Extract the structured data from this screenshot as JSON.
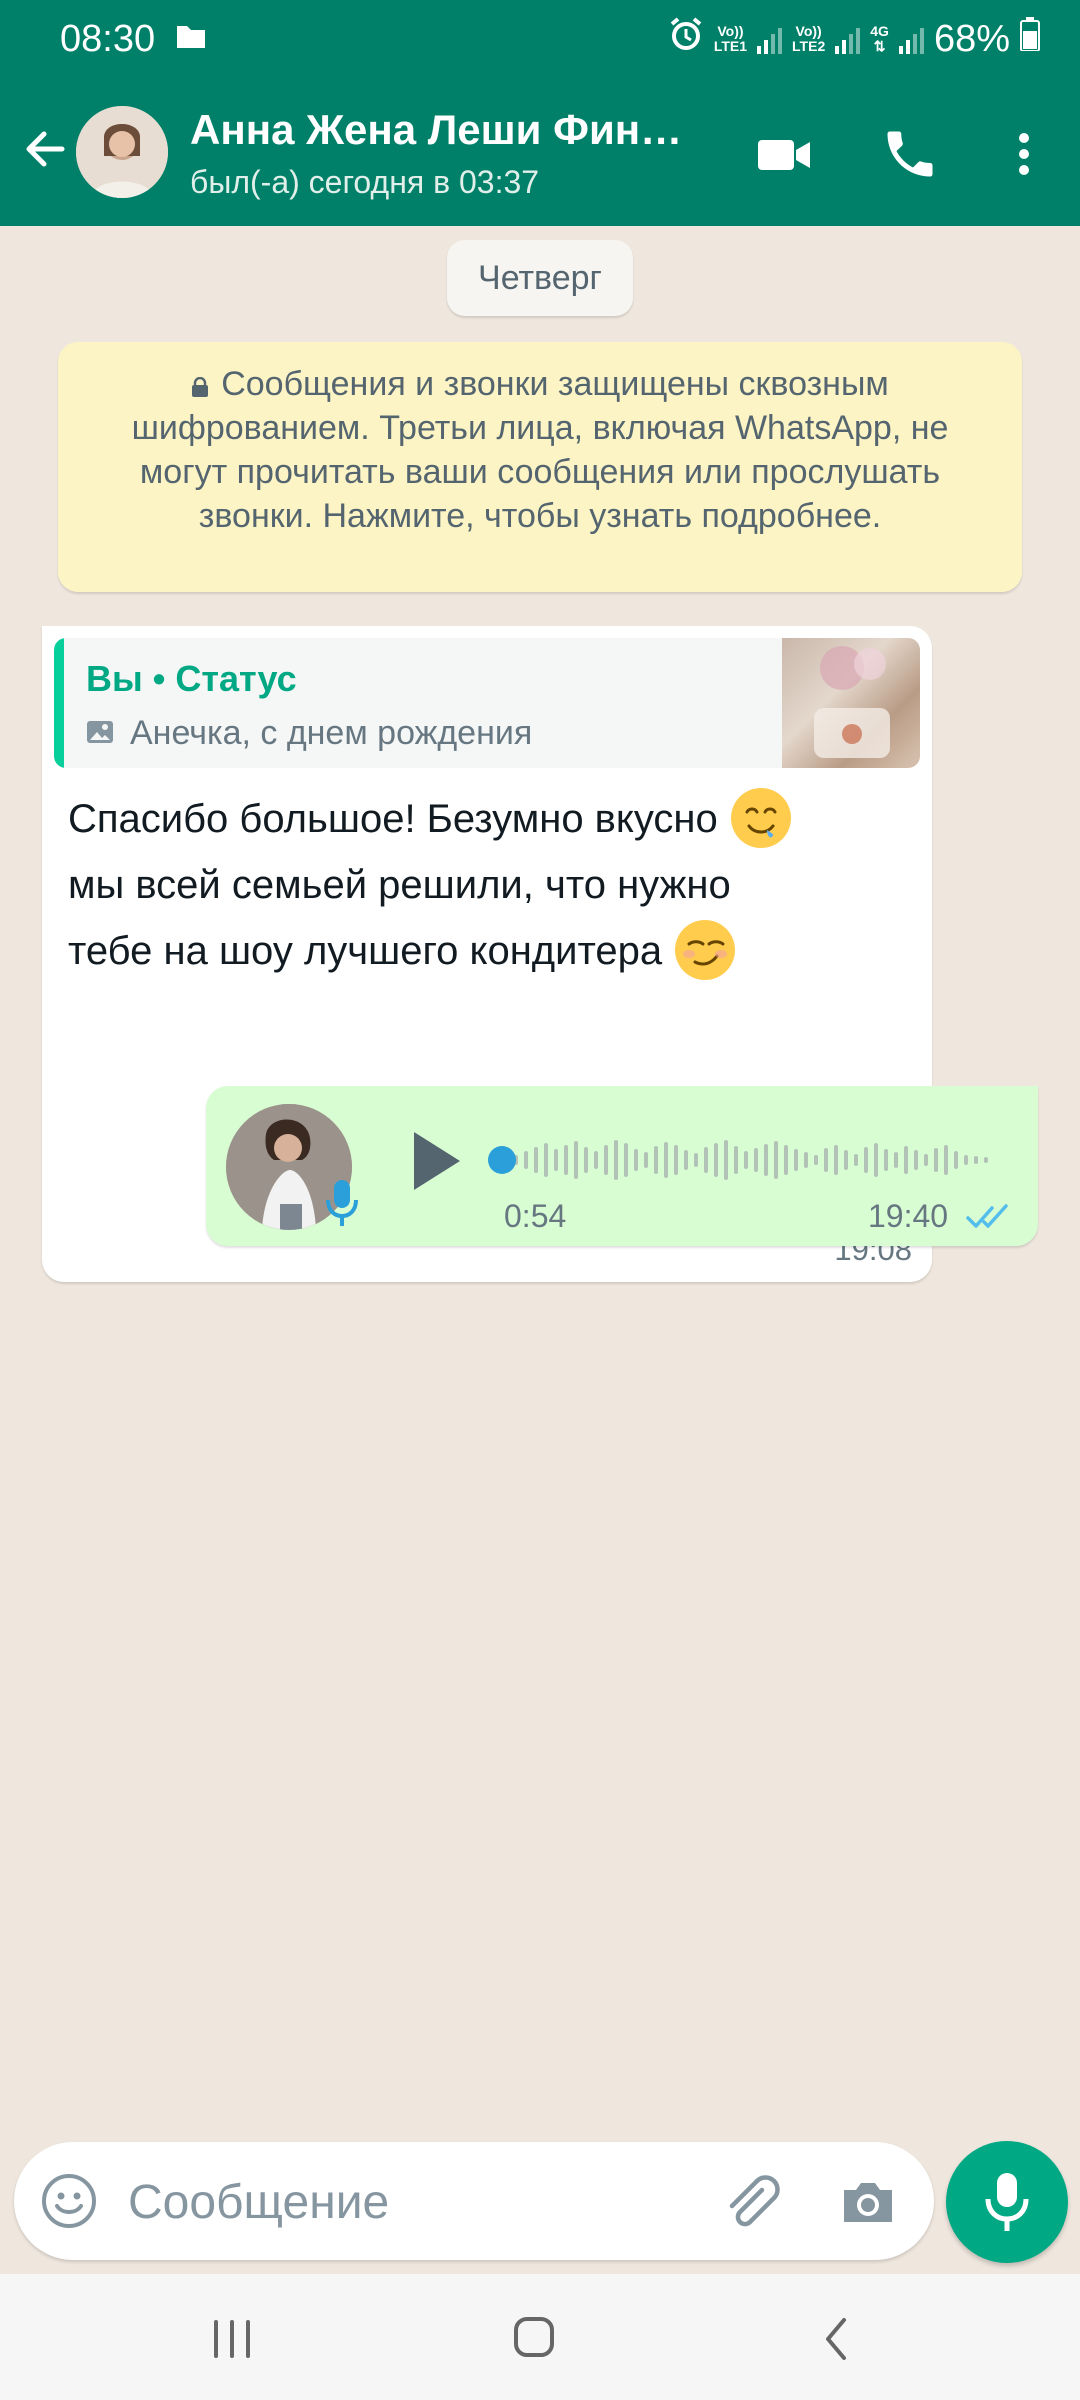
{
  "status_bar": {
    "time": "08:30",
    "sim1_top": "Vo))",
    "sim1_bottom": "LTE1",
    "sim2_top": "Vo))",
    "sim2_bottom": "LTE2",
    "network": "4G",
    "battery": "68%",
    "icons": [
      "folder-icon",
      "alarm-icon",
      "signal-icon",
      "battery-icon"
    ]
  },
  "header": {
    "contact_name": "Анна Жена Леши Фин…",
    "last_seen": "был(-а) сегодня в 03:37",
    "icons": [
      "back-arrow-icon",
      "video-call-icon",
      "voice-call-icon",
      "more-vert-icon"
    ]
  },
  "chat": {
    "day_label": "Четверг",
    "encryption_notice": "Сообщения и звонки защищены сквозным шифрованием. Третьи лица, включая WhatsApp, не могут прочитать ваши сообщения или прослушать звонки. Нажмите, чтобы узнать подробнее.",
    "incoming": {
      "reply_author": "Вы • Статус",
      "reply_text": "Анечка,  с днем рождения",
      "line1": "Спасибо большое! Безумно вкусно",
      "line2": "мы всей семьей решили, что нужно",
      "line3": "тебе на шоу лучшего кондитера",
      "time": "19:08"
    },
    "outgoing_voice": {
      "duration": "0:54",
      "time": "19:40",
      "progress": 0.0,
      "status": "read"
    }
  },
  "composer": {
    "placeholder": "Сообщение",
    "value": ""
  },
  "colors": {
    "header_green": "#008069",
    "accent_green": "#00a884",
    "outgoing_bubble": "#d9fdd3",
    "notice_yellow": "#fdf4c5",
    "read_ticks": "#53bdeb",
    "chat_background": "#efe7de"
  }
}
